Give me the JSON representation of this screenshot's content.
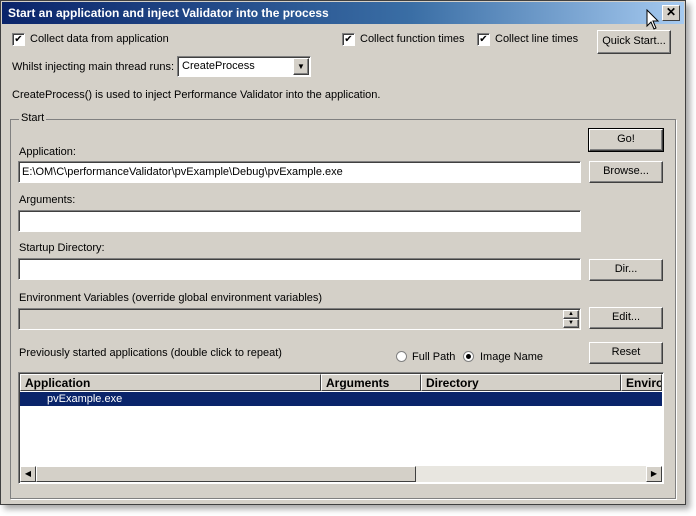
{
  "window": {
    "title": "Start an application and inject Validator into the process",
    "close_glyph": "✕"
  },
  "options": {
    "collect_data_label": "Collect data from application",
    "collect_data_checked": true,
    "collect_function_times_label": "Collect function times",
    "collect_function_times_checked": true,
    "collect_line_times_label": "Collect line times",
    "collect_line_times_checked": true,
    "quick_start_label": "Quick Start...",
    "injecting_label": "Whilst injecting main thread runs:",
    "injecting_value": "CreateProcess",
    "info_text": "CreateProcess() is used to inject Performance Validator into the application."
  },
  "start_group": {
    "label": "Start",
    "go_label": "Go!",
    "application_label": "Application:",
    "application_value": "E:\\OM\\C\\performanceValidator\\pvExample\\Debug\\pvExample.exe",
    "browse_label": "Browse...",
    "arguments_label": "Arguments:",
    "arguments_value": "",
    "startup_dir_label": "Startup Directory:",
    "startup_dir_value": "",
    "dir_label": "Dir...",
    "env_label": "Environment Variables (override global environment variables)",
    "env_value": "",
    "edit_label": "Edit...",
    "previous_label": "Previously started applications (double click to repeat)",
    "full_path_label": "Full Path",
    "image_name_label": "Image Name",
    "selected_path_mode": "Image Name",
    "reset_label": "Reset"
  },
  "history": {
    "columns": [
      "Application",
      "Arguments",
      "Directory",
      "Enviro"
    ],
    "rows": [
      {
        "application": "pvExample.exe",
        "arguments": "",
        "directory": "",
        "environment": ""
      }
    ]
  },
  "icons": {
    "checkmark": "✔",
    "dropdown": "▼",
    "scroll_left": "◀",
    "scroll_right": "▶",
    "spin_up": "▲",
    "spin_down": "▼"
  }
}
